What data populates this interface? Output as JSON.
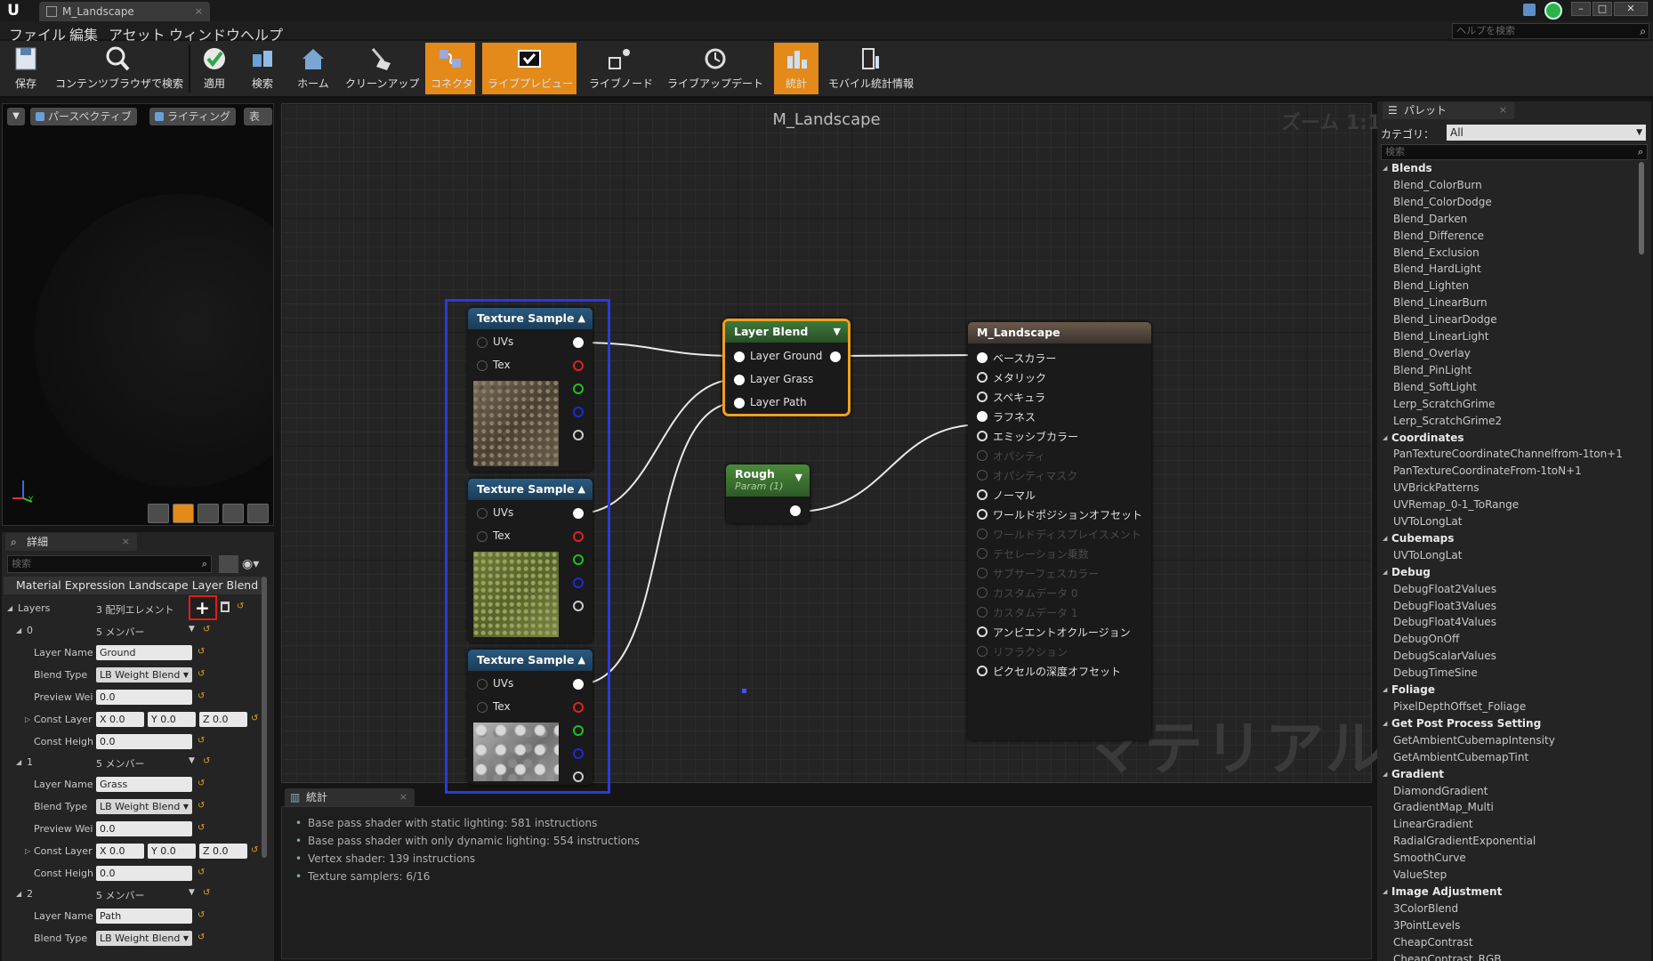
{
  "window": {
    "tab_title": "M_Landscape",
    "tab_close": "×"
  },
  "menu": [
    "ファイル",
    "編集",
    "アセット",
    "ウィンドウ",
    "ヘルプ"
  ],
  "help_search_placeholder": "ヘルプを検索",
  "toolbar": [
    {
      "label": "保存",
      "icon": "save-icon",
      "active": false
    },
    {
      "label": "コンテンツブラウザで検索",
      "icon": "browse-icon",
      "active": false
    },
    {
      "label": "適用",
      "icon": "apply-icon",
      "active": false
    },
    {
      "label": "検索",
      "icon": "search-icon",
      "active": false
    },
    {
      "label": "ホーム",
      "icon": "home-icon",
      "active": false
    },
    {
      "label": "クリーンアップ",
      "icon": "cleanup-icon",
      "active": false
    },
    {
      "label": "コネクタ",
      "icon": "connector-icon",
      "active": true
    },
    {
      "label": "ライブプレビュー",
      "icon": "live-preview-icon",
      "active": true
    },
    {
      "label": "ライブノード",
      "icon": "live-nodes-icon",
      "active": false
    },
    {
      "label": "ライブアップデート",
      "icon": "live-update-icon",
      "active": false
    },
    {
      "label": "統計",
      "icon": "stats-icon",
      "active": true
    },
    {
      "label": "モバイル統計情報",
      "icon": "mobile-stats-icon",
      "active": false
    }
  ],
  "viewport": {
    "perspective": "パースペクティブ",
    "lighting": "ライティング",
    "show": "表示"
  },
  "details": {
    "tab": "詳細",
    "search_placeholder": "検索",
    "header": "Material Expression Landscape Layer Blend",
    "layers_label": "Layers",
    "layers_value": "3 配列エレメント",
    "members": "5 メンバー",
    "layers": [
      {
        "index": "0",
        "name": "Ground",
        "blend_type": "LB Weight Blend",
        "preview": "0.0",
        "const_x": "0.0",
        "const_y": "0.0",
        "const_z": "0.0",
        "const_height": "0.0"
      },
      {
        "index": "1",
        "name": "Grass",
        "blend_type": "LB Weight Blend",
        "preview": "0.0",
        "const_x": "0.0",
        "const_y": "0.0",
        "const_z": "0.0",
        "const_height": "0.0"
      },
      {
        "index": "2",
        "name": "Path",
        "blend_type": "LB Weight Blend"
      }
    ],
    "labels": {
      "layer_name": "Layer Name",
      "blend_type": "Blend Type",
      "preview": "Preview Wei",
      "const_layer": "Const Layer",
      "const_height": "Const Heigh",
      "x": "X",
      "y": "Y",
      "z": "Z"
    }
  },
  "graph": {
    "title": "M_Landscape",
    "zoom": "ズーム 1:1",
    "watermark": "マテリアル",
    "texture_sample_title": "Texture Sample",
    "uvs": "UVs",
    "tex": "Tex",
    "layer_blend": {
      "title": "Layer Blend",
      "pins": [
        "Layer Ground",
        "Layer Grass",
        "Layer Path"
      ]
    },
    "rough": {
      "title": "Rough",
      "sub": "Param (1)"
    },
    "material": {
      "title": "M_Landscape",
      "pins": [
        {
          "label": "ベースカラー",
          "enabled": true
        },
        {
          "label": "メタリック",
          "enabled": true
        },
        {
          "label": "スペキュラ",
          "enabled": true
        },
        {
          "label": "ラフネス",
          "enabled": true
        },
        {
          "label": "エミッシブカラー",
          "enabled": true
        },
        {
          "label": "オパシティ",
          "enabled": false
        },
        {
          "label": "オパシティマスク",
          "enabled": false
        },
        {
          "label": "ノーマル",
          "enabled": true
        },
        {
          "label": "ワールドポジションオフセット",
          "enabled": true
        },
        {
          "label": "ワールドディスプレイスメント",
          "enabled": false
        },
        {
          "label": "テセレーション乗数",
          "enabled": false
        },
        {
          "label": "サブサーフェスカラー",
          "enabled": false
        },
        {
          "label": "カスタムデータ 0",
          "enabled": false
        },
        {
          "label": "カスタムデータ 1",
          "enabled": false
        },
        {
          "label": "アンビエントオクルージョン",
          "enabled": true
        },
        {
          "label": "リフラクション",
          "enabled": false
        },
        {
          "label": "ピクセルの深度オフセット",
          "enabled": true
        }
      ]
    }
  },
  "stats": {
    "tab": "統計",
    "lines": [
      "Base pass shader with static lighting: 581 instructions",
      "Base pass shader with only dynamic lighting: 554 instructions",
      "Vertex shader: 139 instructions",
      "Texture samplers: 6/16"
    ]
  },
  "palette": {
    "tab": "パレット",
    "category_label": "カテゴリ：",
    "category_value": "All",
    "search_placeholder": "検索",
    "groups": [
      {
        "name": "Blends",
        "items": [
          "Blend_ColorBurn",
          "Blend_ColorDodge",
          "Blend_Darken",
          "Blend_Difference",
          "Blend_Exclusion",
          "Blend_HardLight",
          "Blend_Lighten",
          "Blend_LinearBurn",
          "Blend_LinearDodge",
          "Blend_LinearLight",
          "Blend_Overlay",
          "Blend_PinLight",
          "Blend_SoftLight",
          "Lerp_ScratchGrime",
          "Lerp_ScratchGrime2"
        ]
      },
      {
        "name": "Coordinates",
        "items": [
          "PanTextureCoordinateChannelfrom-1ton+1",
          "PanTextureCoordinateFrom-1toN+1",
          "UVBrickPatterns",
          "UVRemap_0-1_ToRange",
          "UVToLongLat"
        ]
      },
      {
        "name": "Cubemaps",
        "items": [
          "UVToLongLat"
        ]
      },
      {
        "name": "Debug",
        "items": [
          "DebugFloat2Values",
          "DebugFloat3Values",
          "DebugFloat4Values",
          "DebugOnOff",
          "DebugScalarValues",
          "DebugTimeSine"
        ]
      },
      {
        "name": "Foliage",
        "items": [
          "PixelDepthOffset_Foliage"
        ]
      },
      {
        "name": "Get Post Process Setting",
        "items": [
          "GetAmbientCubemapIntensity",
          "GetAmbientCubemapTint"
        ]
      },
      {
        "name": "Gradient",
        "items": [
          "DiamondGradient",
          "GradientMap_Multi",
          "LinearGradient",
          "RadialGradientExponential",
          "SmoothCurve",
          "ValueStep"
        ]
      },
      {
        "name": "Image Adjustment",
        "items": [
          "3ColorBlend",
          "3PointLevels",
          "CheapContrast",
          "CheapContrast_RGB"
        ]
      }
    ]
  },
  "colors": {
    "accent": "#e38a1a",
    "selection": "#2c3bd8",
    "highlight": "#e21b1b"
  }
}
